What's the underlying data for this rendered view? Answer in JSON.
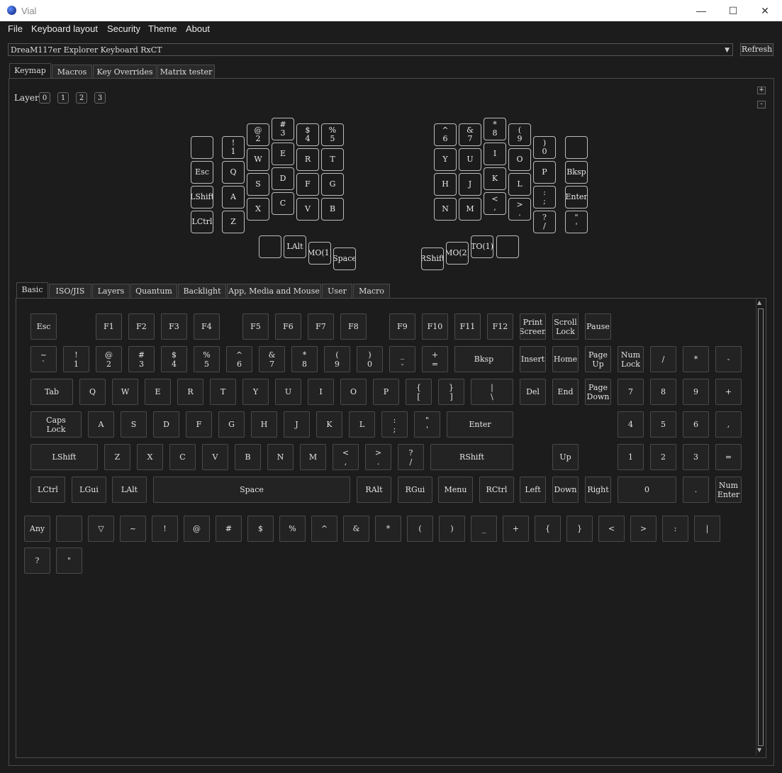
{
  "window": {
    "title": "Vial",
    "minimize": "—",
    "maximize": "☐",
    "close": "✕"
  },
  "menu": [
    "File",
    "Keyboard layout",
    "Security",
    "Theme",
    "About"
  ],
  "device": {
    "selected": "DreaM117er Explorer Keyboard RxCT",
    "refresh_label": "Refresh"
  },
  "main_tabs": [
    "Keymap",
    "Macros",
    "Key Overrides",
    "Matrix tester"
  ],
  "layer": {
    "label": "Layer",
    "buttons": [
      "0",
      "1",
      "2",
      "3"
    ],
    "plus": "+",
    "minus": "-"
  },
  "keyboard_keys": [
    {
      "id": "l-top0",
      "l": [
        "",
        ""
      ]
    },
    {
      "id": "l-1",
      "l": [
        "!",
        "1"
      ]
    },
    {
      "id": "l-2",
      "l": [
        "@",
        "2"
      ]
    },
    {
      "id": "l-3",
      "l": [
        "#",
        "3"
      ]
    },
    {
      "id": "l-4",
      "l": [
        "$",
        "4"
      ]
    },
    {
      "id": "l-5",
      "l": [
        "%",
        "5"
      ]
    },
    {
      "id": "l-esc",
      "l": [
        "Esc"
      ]
    },
    {
      "id": "l-q",
      "l": [
        "Q"
      ]
    },
    {
      "id": "l-w",
      "l": [
        "W"
      ]
    },
    {
      "id": "l-e",
      "l": [
        "E"
      ]
    },
    {
      "id": "l-r",
      "l": [
        "R"
      ]
    },
    {
      "id": "l-t",
      "l": [
        "T"
      ]
    },
    {
      "id": "l-lshift",
      "l": [
        "LShift"
      ]
    },
    {
      "id": "l-a",
      "l": [
        "A"
      ]
    },
    {
      "id": "l-s",
      "l": [
        "S"
      ]
    },
    {
      "id": "l-d",
      "l": [
        "D"
      ]
    },
    {
      "id": "l-f",
      "l": [
        "F"
      ]
    },
    {
      "id": "l-g",
      "l": [
        "G"
      ]
    },
    {
      "id": "l-lctrl",
      "l": [
        "LCtrl"
      ]
    },
    {
      "id": "l-z",
      "l": [
        "Z"
      ]
    },
    {
      "id": "l-x",
      "l": [
        "X"
      ]
    },
    {
      "id": "l-c",
      "l": [
        "C"
      ]
    },
    {
      "id": "l-v",
      "l": [
        "V"
      ]
    },
    {
      "id": "l-b",
      "l": [
        "B"
      ]
    },
    {
      "id": "l-th0",
      "l": [
        ""
      ]
    },
    {
      "id": "l-lalt",
      "l": [
        "LAlt"
      ]
    },
    {
      "id": "l-mo1",
      "l": [
        "MO(1)"
      ]
    },
    {
      "id": "l-space",
      "l": [
        "Space"
      ]
    },
    {
      "id": "r-6",
      "l": [
        "^",
        "6"
      ]
    },
    {
      "id": "r-7",
      "l": [
        "&",
        "7"
      ]
    },
    {
      "id": "r-8",
      "l": [
        "*",
        "8"
      ]
    },
    {
      "id": "r-9",
      "l": [
        "(",
        "9"
      ]
    },
    {
      "id": "r-0",
      "l": [
        ")",
        "0"
      ]
    },
    {
      "id": "r-top",
      "l": [
        ""
      ]
    },
    {
      "id": "r-y",
      "l": [
        "Y"
      ]
    },
    {
      "id": "r-u",
      "l": [
        "U"
      ]
    },
    {
      "id": "r-i",
      "l": [
        "I"
      ]
    },
    {
      "id": "r-o",
      "l": [
        "O"
      ]
    },
    {
      "id": "r-p",
      "l": [
        "P"
      ]
    },
    {
      "id": "r-bksp",
      "l": [
        "Bksp"
      ]
    },
    {
      "id": "r-h",
      "l": [
        "H"
      ]
    },
    {
      "id": "r-j",
      "l": [
        "J"
      ]
    },
    {
      "id": "r-k",
      "l": [
        "K"
      ]
    },
    {
      "id": "r-l",
      "l": [
        "L"
      ]
    },
    {
      "id": "r-semi",
      "l": [
        ":",
        ";"
      ]
    },
    {
      "id": "r-enter",
      "l": [
        "Enter"
      ]
    },
    {
      "id": "r-n",
      "l": [
        "N"
      ]
    },
    {
      "id": "r-m",
      "l": [
        "M"
      ]
    },
    {
      "id": "r-comma",
      "l": [
        "<",
        ","
      ]
    },
    {
      "id": "r-dot",
      "l": [
        ">",
        "."
      ]
    },
    {
      "id": "r-slash",
      "l": [
        "?",
        "/"
      ]
    },
    {
      "id": "r-quote",
      "l": [
        "\"",
        "'"
      ]
    },
    {
      "id": "r-rshift",
      "l": [
        "RShift"
      ]
    },
    {
      "id": "r-mo2",
      "l": [
        "MO(2)"
      ]
    },
    {
      "id": "r-to1",
      "l": [
        "TO(1)"
      ]
    },
    {
      "id": "r-th3",
      "l": [
        ""
      ]
    }
  ],
  "picker_tabs": [
    "Basic",
    "ISO/JIS",
    "Layers",
    "Quantum",
    "Backlight",
    "App, Media and Mouse",
    "User",
    "Macro"
  ],
  "picker_keys": [
    {
      "l": [
        "Esc"
      ]
    },
    {
      "l": [
        "F1"
      ]
    },
    {
      "l": [
        "F2"
      ]
    },
    {
      "l": [
        "F3"
      ]
    },
    {
      "l": [
        "F4"
      ]
    },
    {
      "l": [
        "F5"
      ]
    },
    {
      "l": [
        "F6"
      ]
    },
    {
      "l": [
        "F7"
      ]
    },
    {
      "l": [
        "F8"
      ]
    },
    {
      "l": [
        "F9"
      ]
    },
    {
      "l": [
        "F10"
      ]
    },
    {
      "l": [
        "F11"
      ]
    },
    {
      "l": [
        "F12"
      ]
    },
    {
      "l": [
        "Print",
        "Screen"
      ]
    },
    {
      "l": [
        "Scroll",
        "Lock"
      ]
    },
    {
      "l": [
        "Pause"
      ]
    },
    {
      "l": [
        "~",
        "`"
      ]
    },
    {
      "l": [
        "!",
        "1"
      ]
    },
    {
      "l": [
        "@",
        "2"
      ]
    },
    {
      "l": [
        "#",
        "3"
      ]
    },
    {
      "l": [
        "$",
        "4"
      ]
    },
    {
      "l": [
        "%",
        "5"
      ]
    },
    {
      "l": [
        "^",
        "6"
      ]
    },
    {
      "l": [
        "&",
        "7"
      ]
    },
    {
      "l": [
        "*",
        "8"
      ]
    },
    {
      "l": [
        "(",
        "9"
      ]
    },
    {
      "l": [
        ")",
        "0"
      ]
    },
    {
      "l": [
        "_",
        "-"
      ]
    },
    {
      "l": [
        "+",
        "="
      ]
    },
    {
      "l": [
        "Bksp"
      ]
    },
    {
      "l": [
        "Insert"
      ]
    },
    {
      "l": [
        "Home"
      ]
    },
    {
      "l": [
        "Page",
        "Up"
      ]
    },
    {
      "l": [
        "Num",
        "Lock"
      ]
    },
    {
      "l": [
        "/"
      ]
    },
    {
      "l": [
        "*"
      ]
    },
    {
      "l": [
        "-"
      ]
    },
    {
      "l": [
        "Tab"
      ]
    },
    {
      "l": [
        "Q"
      ]
    },
    {
      "l": [
        "W"
      ]
    },
    {
      "l": [
        "E"
      ]
    },
    {
      "l": [
        "R"
      ]
    },
    {
      "l": [
        "T"
      ]
    },
    {
      "l": [
        "Y"
      ]
    },
    {
      "l": [
        "U"
      ]
    },
    {
      "l": [
        "I"
      ]
    },
    {
      "l": [
        "O"
      ]
    },
    {
      "l": [
        "P"
      ]
    },
    {
      "l": [
        "{",
        "["
      ]
    },
    {
      "l": [
        "}",
        "]"
      ]
    },
    {
      "l": [
        "|",
        "\\"
      ]
    },
    {
      "l": [
        "Del"
      ]
    },
    {
      "l": [
        "End"
      ]
    },
    {
      "l": [
        "Page",
        "Down"
      ]
    },
    {
      "l": [
        "7"
      ]
    },
    {
      "l": [
        "8"
      ]
    },
    {
      "l": [
        "9"
      ]
    },
    {
      "l": [
        "+"
      ]
    },
    {
      "l": [
        "Caps",
        "Lock"
      ]
    },
    {
      "l": [
        "A"
      ]
    },
    {
      "l": [
        "S"
      ]
    },
    {
      "l": [
        "D"
      ]
    },
    {
      "l": [
        "F"
      ]
    },
    {
      "l": [
        "G"
      ]
    },
    {
      "l": [
        "H"
      ]
    },
    {
      "l": [
        "J"
      ]
    },
    {
      "l": [
        "K"
      ]
    },
    {
      "l": [
        "L"
      ]
    },
    {
      "l": [
        ":",
        ";"
      ]
    },
    {
      "l": [
        "\"",
        "'"
      ]
    },
    {
      "l": [
        "Enter"
      ]
    },
    {
      "l": [
        "4"
      ]
    },
    {
      "l": [
        "5"
      ]
    },
    {
      "l": [
        "6"
      ]
    },
    {
      "l": [
        ","
      ]
    },
    {
      "l": [
        "LShift"
      ]
    },
    {
      "l": [
        "Z"
      ]
    },
    {
      "l": [
        "X"
      ]
    },
    {
      "l": [
        "C"
      ]
    },
    {
      "l": [
        "V"
      ]
    },
    {
      "l": [
        "B"
      ]
    },
    {
      "l": [
        "N"
      ]
    },
    {
      "l": [
        "M"
      ]
    },
    {
      "l": [
        "<",
        ","
      ]
    },
    {
      "l": [
        ">",
        "."
      ]
    },
    {
      "l": [
        "?",
        "/"
      ]
    },
    {
      "l": [
        "RShift"
      ]
    },
    {
      "l": [
        "Up"
      ]
    },
    {
      "l": [
        "1"
      ]
    },
    {
      "l": [
        "2"
      ]
    },
    {
      "l": [
        "3"
      ]
    },
    {
      "l": [
        "="
      ]
    },
    {
      "l": [
        "LCtrl"
      ]
    },
    {
      "l": [
        "LGui"
      ]
    },
    {
      "l": [
        "LAlt"
      ]
    },
    {
      "l": [
        "Space"
      ]
    },
    {
      "l": [
        "RAlt"
      ]
    },
    {
      "l": [
        "RGui"
      ]
    },
    {
      "l": [
        "Menu"
      ]
    },
    {
      "l": [
        "RCtrl"
      ]
    },
    {
      "l": [
        "Left"
      ]
    },
    {
      "l": [
        "Down"
      ]
    },
    {
      "l": [
        "Right"
      ]
    },
    {
      "l": [
        "0"
      ]
    },
    {
      "l": [
        "."
      ]
    },
    {
      "l": [
        "Num",
        "Enter"
      ]
    },
    {
      "l": [
        "Any"
      ]
    },
    {
      "l": [
        ""
      ]
    },
    {
      "l": [
        "▽"
      ]
    },
    {
      "l": [
        "~"
      ]
    },
    {
      "l": [
        "!"
      ]
    },
    {
      "l": [
        "@"
      ]
    },
    {
      "l": [
        "#"
      ]
    },
    {
      "l": [
        "$"
      ]
    },
    {
      "l": [
        "%"
      ]
    },
    {
      "l": [
        "^"
      ]
    },
    {
      "l": [
        "&"
      ]
    },
    {
      "l": [
        "*"
      ]
    },
    {
      "l": [
        "("
      ]
    },
    {
      "l": [
        ")"
      ]
    },
    {
      "l": [
        "_"
      ]
    },
    {
      "l": [
        "+"
      ]
    },
    {
      "l": [
        "{"
      ]
    },
    {
      "l": [
        "}"
      ]
    },
    {
      "l": [
        "<"
      ]
    },
    {
      "l": [
        ">"
      ]
    },
    {
      "l": [
        ":"
      ]
    },
    {
      "l": [
        "|"
      ]
    },
    {
      "l": [
        "?"
      ]
    },
    {
      "l": [
        "\""
      ]
    }
  ],
  "scroll_up": "▲",
  "scroll_down": "▼"
}
